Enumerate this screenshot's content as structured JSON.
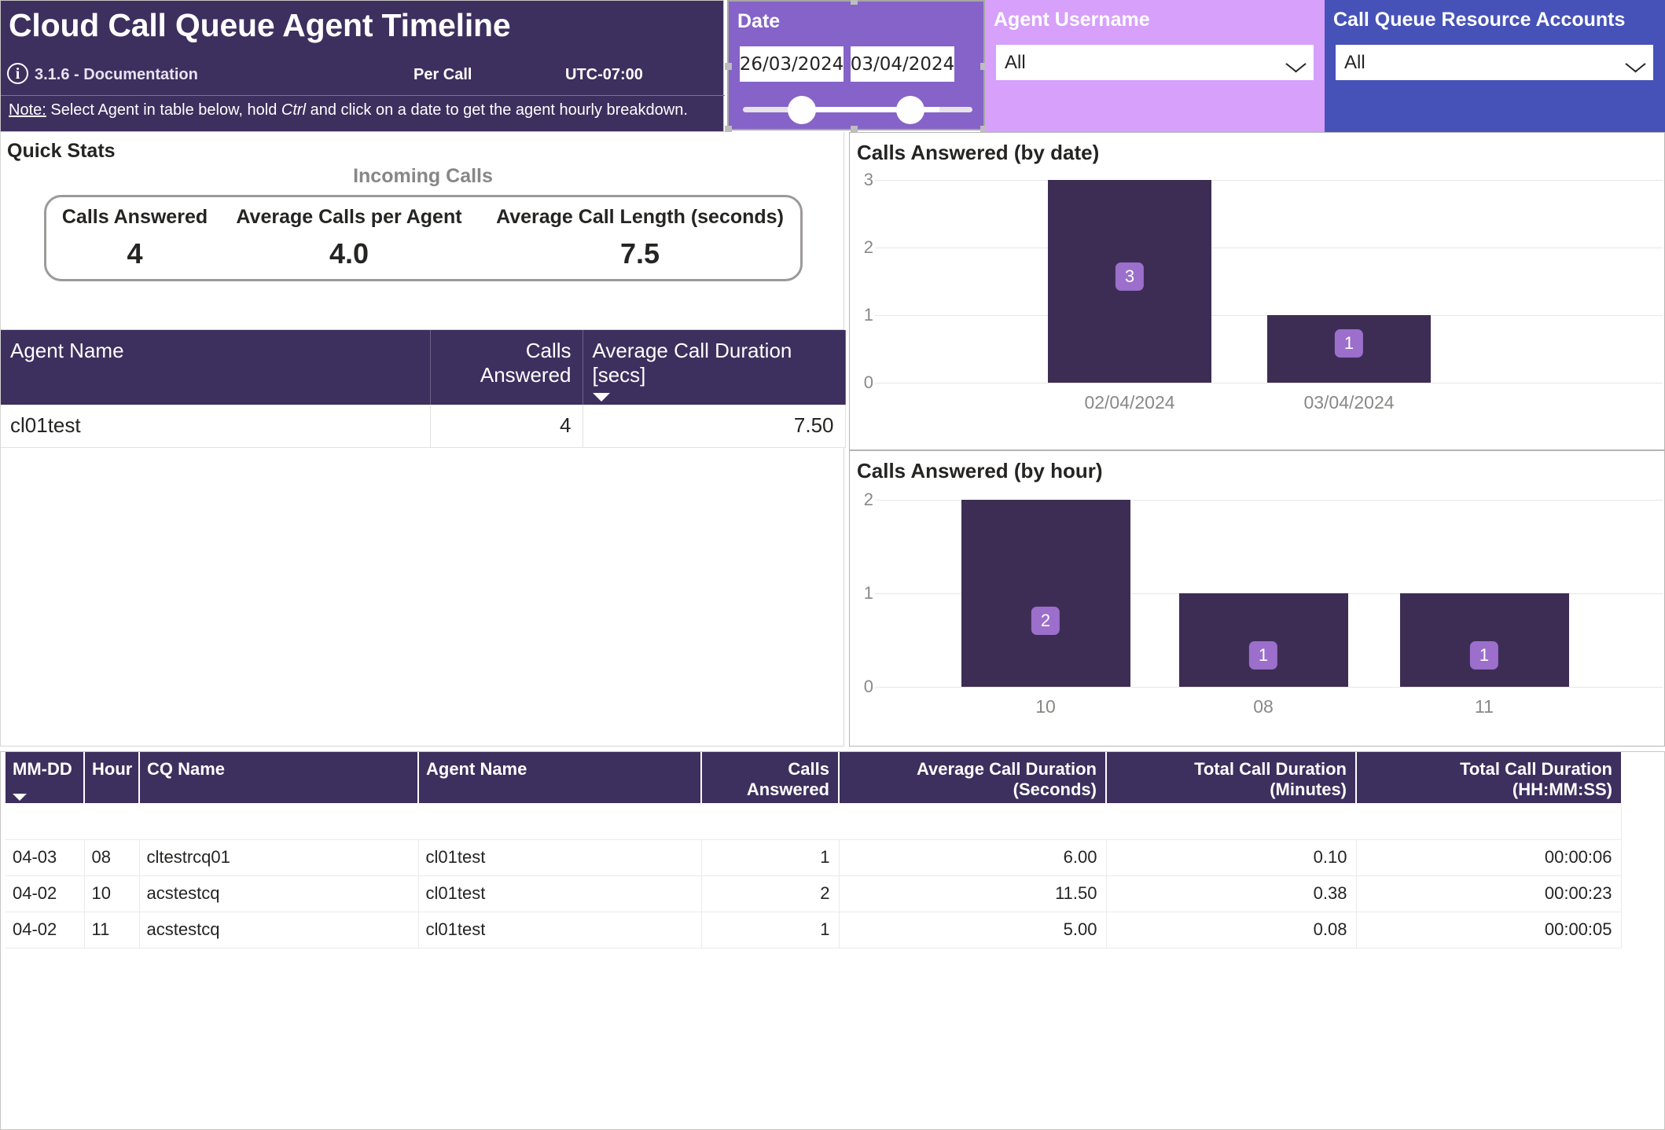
{
  "header": {
    "title": "Cloud Call Queue Agent Timeline",
    "info_icon": "info-icon",
    "version": "3.1.6 - Documentation",
    "per_call": "Per Call",
    "timezone": "UTC-07:00",
    "note_prefix": "Note:",
    "note_part1": " Select Agent in table below, hold ",
    "note_emphasis": "Ctrl",
    "note_part2": " and click on a date to get the agent hourly breakdown."
  },
  "slicers": {
    "date": {
      "label": "Date",
      "start": "26/03/2024",
      "end": "03/04/2024"
    },
    "agent_username": {
      "label": "Agent Username",
      "value": "All",
      "chevron": "chevron-down-icon"
    },
    "cq_resource_accounts": {
      "label": "Call Queue Resource Accounts",
      "value": "All",
      "chevron": "chevron-down-icon"
    }
  },
  "quick_stats": {
    "panel_title": "Quick Stats",
    "section_title": "Incoming Calls",
    "metrics": [
      {
        "label": "Calls Answered",
        "value": "4"
      },
      {
        "label": "Average Calls per Agent",
        "value": "4.0"
      },
      {
        "label": "Average Call Length (seconds)",
        "value": "7.5"
      }
    ]
  },
  "agent_table": {
    "columns": [
      "Agent Name",
      "Calls Answered",
      "Average Call Duration [secs]"
    ],
    "sorted_column_index": 2,
    "rows": [
      {
        "agent_name": "cl01test",
        "calls_answered": "4",
        "avg_call_duration": "7.50"
      }
    ]
  },
  "chart_data": [
    {
      "type": "bar",
      "title": "Calls Answered (by date)",
      "categories": [
        "02/04/2024",
        "03/04/2024"
      ],
      "values": [
        3,
        1
      ],
      "labels": [
        "3",
        "1"
      ],
      "xlabel": "",
      "ylabel": "",
      "ylim": [
        0,
        3
      ],
      "yticks": [
        0,
        1,
        2,
        3
      ],
      "grid": true,
      "legend": "none",
      "bar_color": "#3D2D54",
      "label_badge_color": "#9B6FCB"
    },
    {
      "type": "bar",
      "title": "Calls Answered (by hour)",
      "categories": [
        "10",
        "08",
        "11"
      ],
      "values": [
        2,
        1,
        1
      ],
      "labels": [
        "2",
        "1",
        "1"
      ],
      "xlabel": "",
      "ylabel": "",
      "ylim": [
        0,
        2
      ],
      "yticks": [
        0,
        1,
        2
      ],
      "grid": true,
      "legend": "none",
      "bar_color": "#3D2D54",
      "label_badge_color": "#9B6FCB"
    }
  ],
  "detail_table": {
    "columns": [
      "MM-DD",
      "Hour",
      "CQ Name",
      "Agent Name",
      "Calls Answered",
      "Average Call Duration (Seconds)",
      "Total Call Duration (Minutes)",
      "Total Call Duration (HH:MM:SS)"
    ],
    "sorted_column_index": 0,
    "rows": [
      {
        "mm_dd": "04-03",
        "hour": "08",
        "cq_name": "cltestrcq01",
        "agent_name": "cl01test",
        "calls_answered": "1",
        "avg_call_duration_sec": "6.00",
        "total_call_duration_min": "0.10",
        "total_call_duration_hms": "00:00:06"
      },
      {
        "mm_dd": "04-02",
        "hour": "10",
        "cq_name": "acstestcq",
        "agent_name": "cl01test",
        "calls_answered": "2",
        "avg_call_duration_sec": "11.50",
        "total_call_duration_min": "0.38",
        "total_call_duration_hms": "00:00:23"
      },
      {
        "mm_dd": "04-02",
        "hour": "11",
        "cq_name": "acstestcq",
        "agent_name": "cl01test",
        "calls_answered": "1",
        "avg_call_duration_sec": "5.00",
        "total_call_duration_min": "0.08",
        "total_call_duration_hms": "00:00:05"
      }
    ]
  },
  "colors": {
    "header_purple": "#3D2F5E",
    "date_slicer_purple": "#8563C8",
    "agent_slicer_lilac": "#D6A0FB",
    "cq_slicer_blue": "#4652B8",
    "bar_fill": "#3D2D54",
    "badge": "#9B6FCB",
    "accent_bar": "#8B5FD4"
  }
}
